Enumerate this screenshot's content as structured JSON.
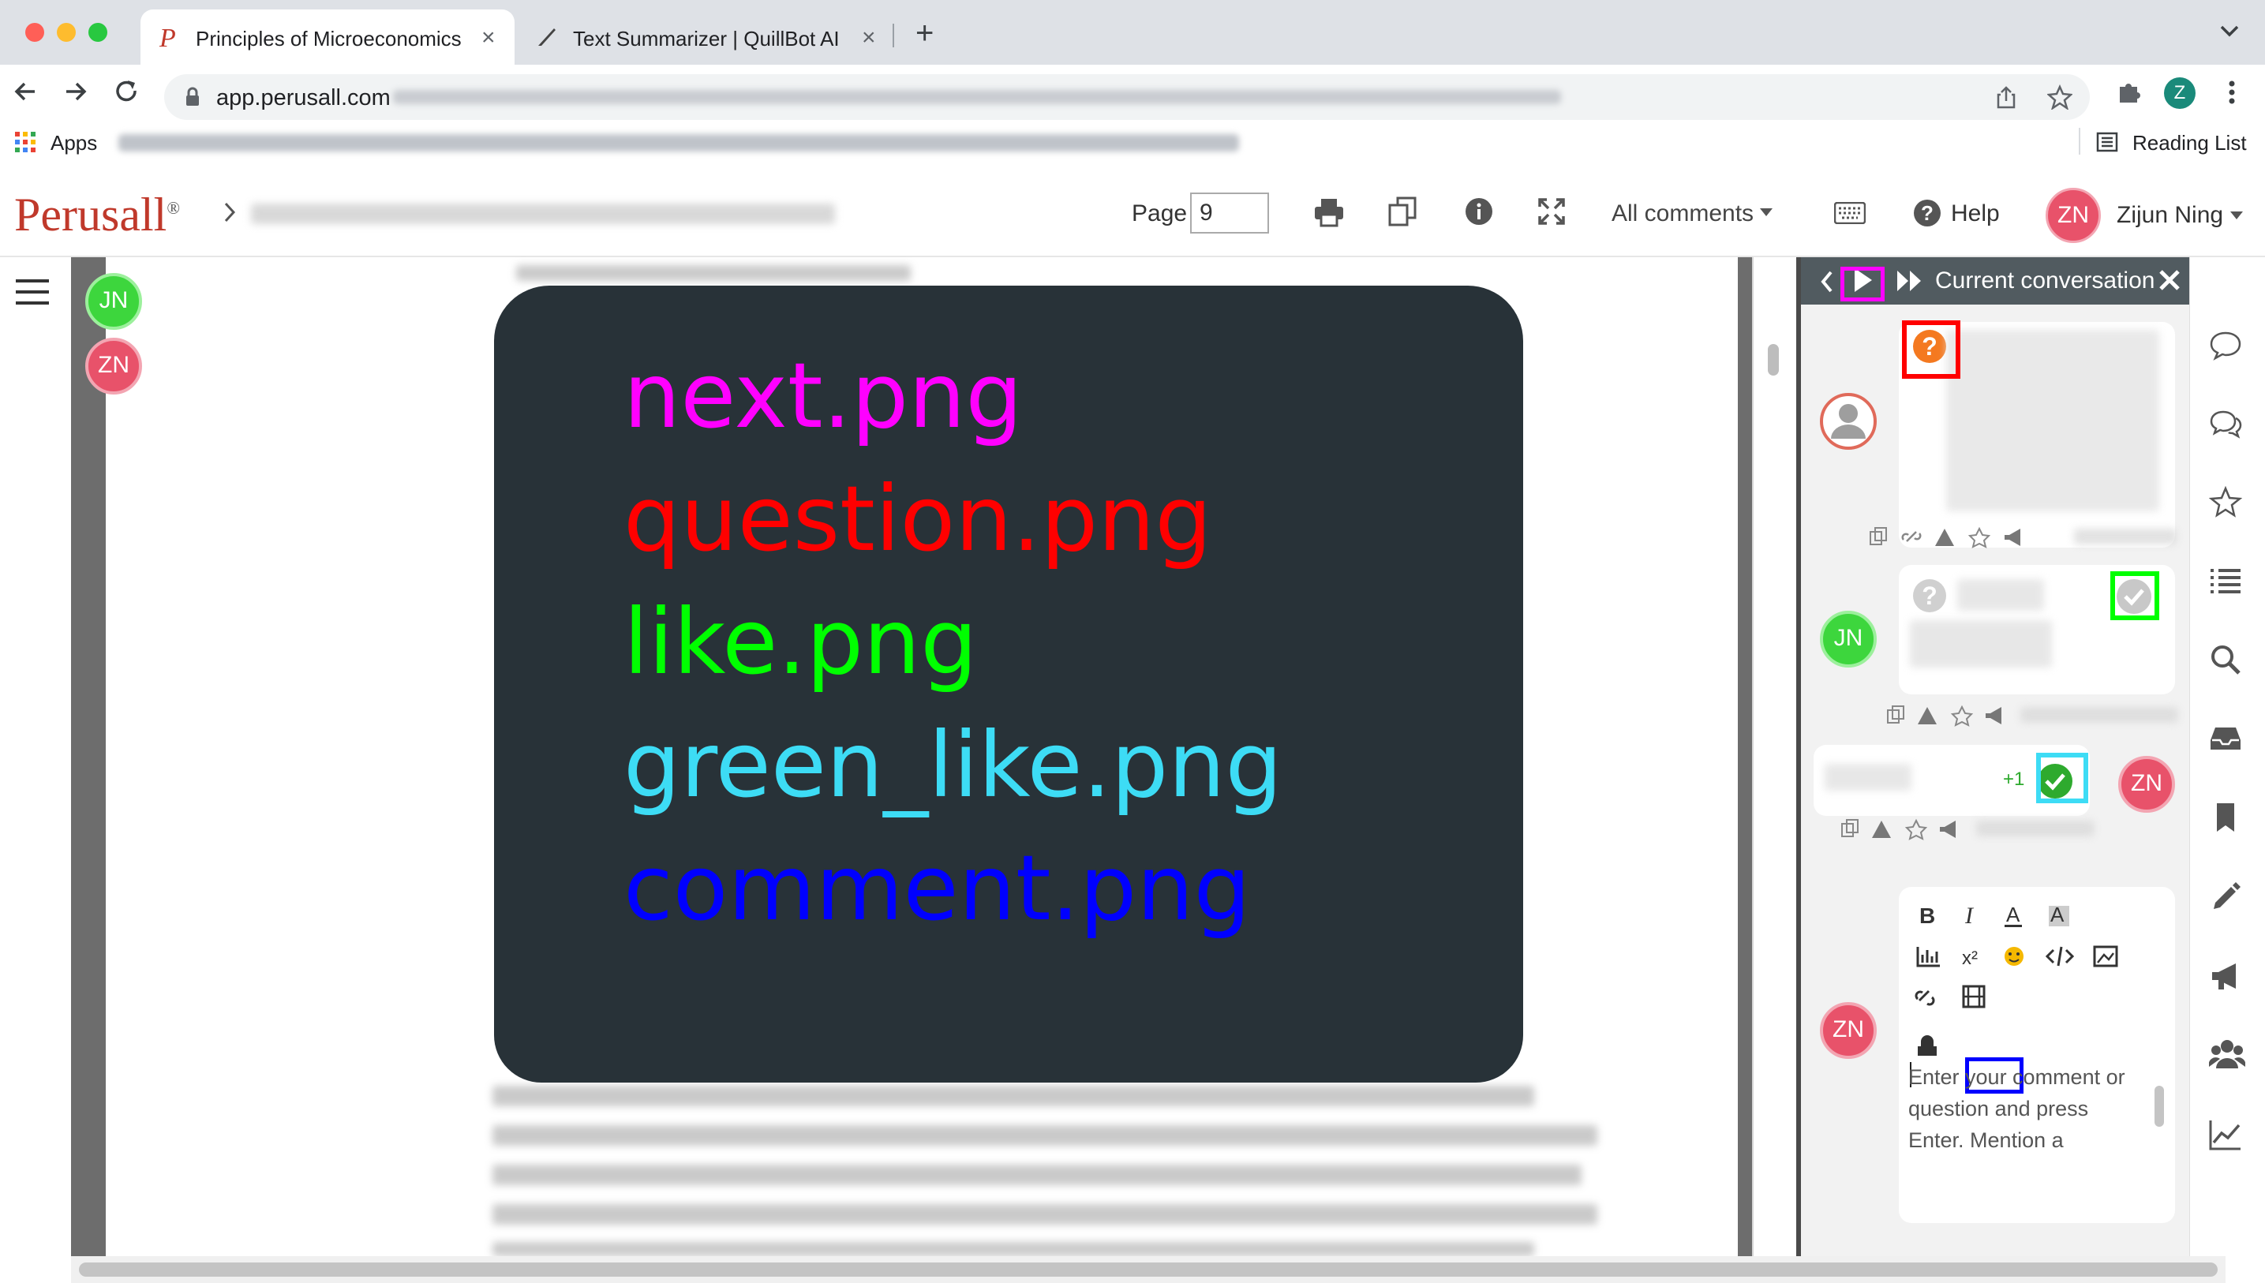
{
  "browser": {
    "tabs": [
      {
        "title": "Principles of Microeconomics",
        "active": true
      },
      {
        "title": "Text Summarizer | QuillBot AI",
        "active": false
      }
    ],
    "url": "app.perusall.com",
    "bookmarks": {
      "apps_label": "Apps",
      "reading_list_label": "Reading List"
    },
    "profile_initial": "Z"
  },
  "app": {
    "logo": "Perusall",
    "page_label": "Page",
    "page_value": "9",
    "filter_label": "All comments",
    "help_label": "Help",
    "user_initials": "ZN",
    "user_name": "Zijun Ning"
  },
  "presence": [
    {
      "initials": "JN",
      "color": "#3dd63d"
    },
    {
      "initials": "ZN",
      "color": "#e8526a"
    }
  ],
  "overlay": {
    "lines": [
      {
        "text": "next.png",
        "color": "#ff00ff"
      },
      {
        "text": "question.png",
        "color": "#ff0000"
      },
      {
        "text": "like.png",
        "color": "#00ff00"
      },
      {
        "text": "green_like.png",
        "color": "#3ddcf5"
      },
      {
        "text": "comment.png",
        "color": "#0000ff"
      }
    ]
  },
  "conversation": {
    "title": "Current conversation",
    "jn_initials": "JN",
    "zn_initials": "ZN",
    "plus_one": "+1",
    "comment_placeholder": "Enter your comment or question and press Enter. Mention a"
  },
  "colors": {
    "highlight_next": "#ff00ff",
    "highlight_question": "#ff0000",
    "highlight_like": "#00ff00",
    "highlight_green_like": "#3ddcf5",
    "highlight_comment": "#0000ff",
    "brand": "#c0392b"
  }
}
